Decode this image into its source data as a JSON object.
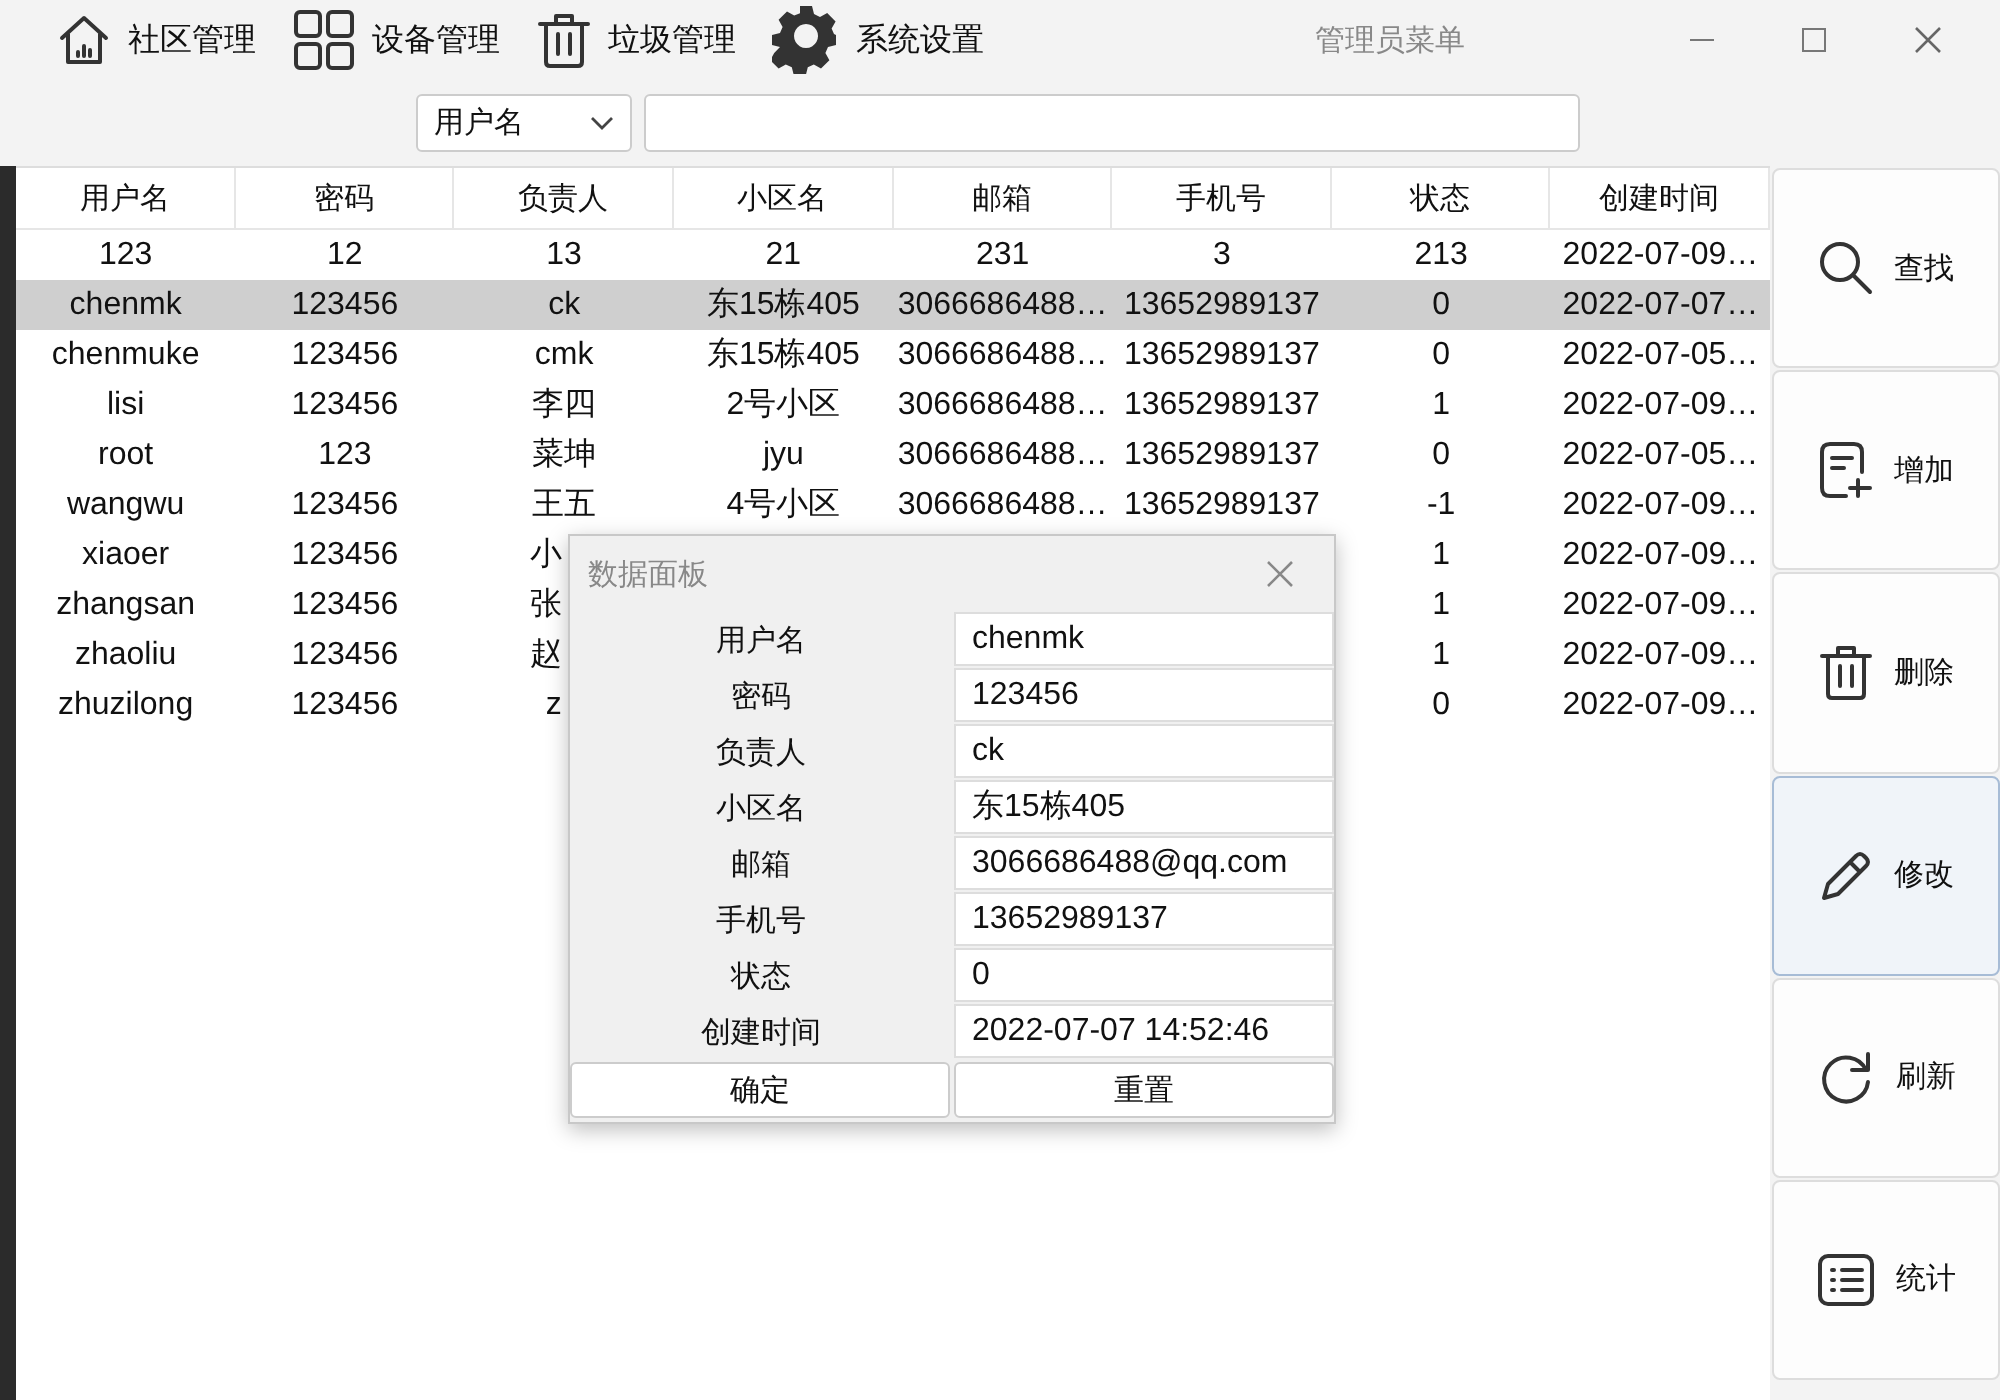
{
  "window": {
    "title": "管理员菜单"
  },
  "nav": [
    {
      "label": "社区管理"
    },
    {
      "label": "设备管理"
    },
    {
      "label": "垃圾管理"
    },
    {
      "label": "系统设置"
    }
  ],
  "search": {
    "field": "用户名"
  },
  "table": {
    "columns": [
      "用户名",
      "密码",
      "负责人",
      "小区名",
      "邮箱",
      "手机号",
      "状态",
      "创建时间"
    ],
    "rows": [
      {
        "selected": false,
        "cells": [
          "123",
          "12",
          "13",
          "21",
          "231",
          "3",
          "213",
          "2022-07-09…"
        ]
      },
      {
        "selected": true,
        "cells": [
          "chenmk",
          "123456",
          "ck",
          "东15栋405",
          "3066686488…",
          "13652989137",
          "0",
          "2022-07-07…"
        ]
      },
      {
        "selected": false,
        "cells": [
          "chenmuke",
          "123456",
          "cmk",
          "东15栋405",
          "3066686488…",
          "13652989137",
          "0",
          "2022-07-05…"
        ]
      },
      {
        "selected": false,
        "cells": [
          "lisi",
          "123456",
          "李四",
          "2号小区",
          "3066686488…",
          "13652989137",
          "1",
          "2022-07-09…"
        ]
      },
      {
        "selected": false,
        "cells": [
          "root",
          "123",
          "菜坤",
          "jyu",
          "3066686488…",
          "13652989137",
          "0",
          "2022-07-05…"
        ]
      },
      {
        "selected": false,
        "cells": [
          "wangwu",
          "123456",
          "王五",
          "4号小区",
          "3066686488…",
          "13652989137",
          "-1",
          "2022-07-09…"
        ]
      },
      {
        "selected": false,
        "cells": [
          "xiaoer",
          "123456",
          "小",
          null,
          null,
          null,
          "1",
          "2022-07-09…"
        ]
      },
      {
        "selected": false,
        "cells": [
          "zhangsan",
          "123456",
          "张",
          null,
          null,
          null,
          "1",
          "2022-07-09…"
        ]
      },
      {
        "selected": false,
        "cells": [
          "zhaoliu",
          "123456",
          "赵",
          null,
          null,
          null,
          "1",
          "2022-07-09…"
        ]
      },
      {
        "selected": false,
        "cells": [
          "zhuzilong",
          "123456",
          "z",
          null,
          null,
          null,
          "0",
          "2022-07-09…"
        ]
      }
    ]
  },
  "actions": [
    {
      "label": "查找",
      "highlighted": false
    },
    {
      "label": "增加",
      "highlighted": false
    },
    {
      "label": "删除",
      "highlighted": false
    },
    {
      "label": "修改",
      "highlighted": true
    },
    {
      "label": "刷新",
      "highlighted": false
    },
    {
      "label": "统计",
      "highlighted": false
    }
  ],
  "dialog": {
    "title": "数据面板",
    "fields": [
      {
        "label": "用户名",
        "value": "chenmk"
      },
      {
        "label": "密码",
        "value": "123456"
      },
      {
        "label": "负责人",
        "value": "ck"
      },
      {
        "label": "小区名",
        "value": "东15栋405"
      },
      {
        "label": "邮箱",
        "value": "3066686488@qq.com"
      },
      {
        "label": "手机号",
        "value": "13652989137"
      },
      {
        "label": "状态",
        "value": "0"
      },
      {
        "label": "创建时间",
        "value": "2022-07-07 14:52:46"
      }
    ],
    "buttons": [
      "确定",
      "重置"
    ]
  }
}
